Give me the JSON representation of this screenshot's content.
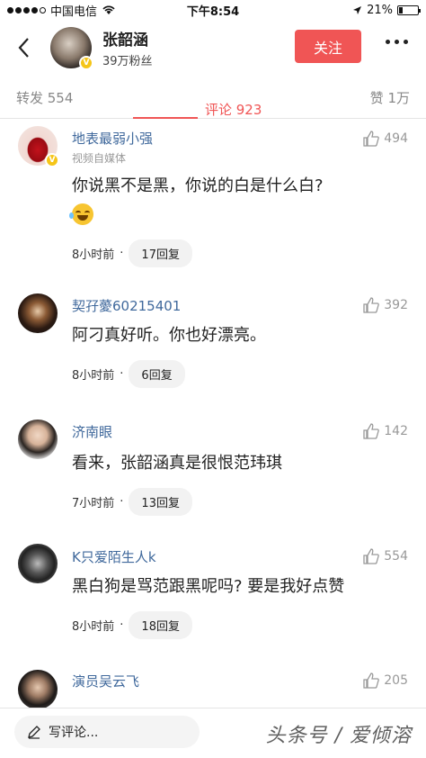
{
  "status_bar": {
    "carrier": "中国电信",
    "time": "下午8:54",
    "battery": "21%",
    "battery_fraction": 0.21
  },
  "header": {
    "name": "张韶涵",
    "fans": "39万粉丝",
    "follow_label": "关注"
  },
  "tabs": {
    "repost": "转发 554",
    "comment": "评论 923",
    "like": "赞 1万"
  },
  "comments": [
    {
      "name": "地表最弱小强",
      "subtitle": "视频自媒体",
      "text": "你说黑不是黑，你说的白是什么白?",
      "likes": "494",
      "time": "8小时前",
      "replies": "17回复"
    },
    {
      "name": "契孖薆60215401",
      "text": "阿刁真好听。你也好漂亮。",
      "likes": "392",
      "time": "8小时前",
      "replies": "6回复"
    },
    {
      "name": "济南眼",
      "text": "看来，张韶涵真是很恨范玮琪",
      "likes": "142",
      "time": "7小时前",
      "replies": "13回复"
    },
    {
      "name": "K只爱陌生人k",
      "text": "黑白狗是骂范跟黑呢吗? 要是我好点赞",
      "likes": "554",
      "time": "8小时前",
      "replies": "18回复"
    },
    {
      "name": "演员吴云飞",
      "likes": "205"
    }
  ],
  "bottom": {
    "write_placeholder": "写评论...",
    "watermark": "头条号 / 爱倾溶"
  },
  "colors": {
    "accent": "#f05555",
    "name_link": "#40699c"
  }
}
